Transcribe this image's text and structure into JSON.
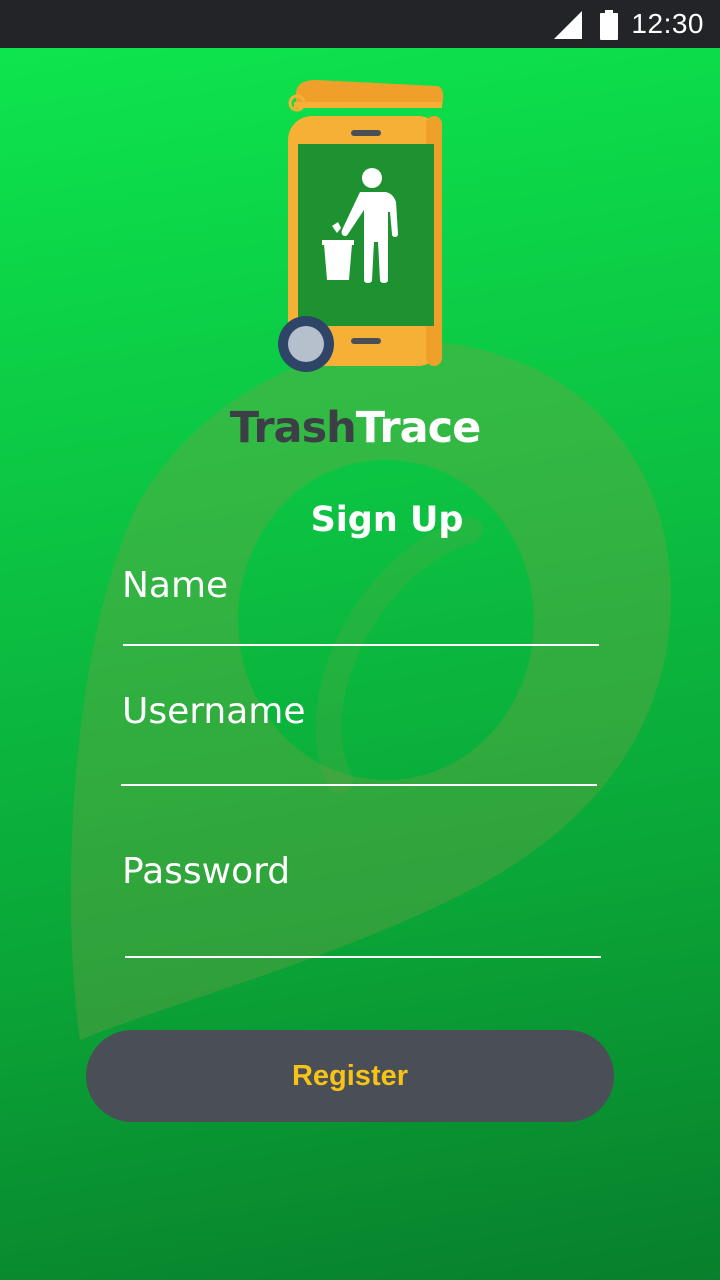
{
  "status_bar": {
    "time": "12:30",
    "icons": [
      "cell-signal-icon",
      "battery-icon"
    ]
  },
  "app": {
    "name_part1": "Trash",
    "name_part2": "Trace",
    "logo_icon": "phone-trash-person-icon"
  },
  "form": {
    "heading": "Sign Up",
    "fields": [
      {
        "label": "Name",
        "value": ""
      },
      {
        "label": "Username",
        "value": ""
      },
      {
        "label": "Password",
        "value": ""
      }
    ],
    "submit_label": "Register"
  },
  "colors": {
    "background_top": "#0de84e",
    "background_bottom": "#087f2c",
    "status_bar": "#232428",
    "title_dark": "#3c3f45",
    "button_bg": "#4a4f57",
    "button_text": "#f7c316",
    "phone_body": "#f6b035",
    "phone_screen": "#1e9230"
  }
}
